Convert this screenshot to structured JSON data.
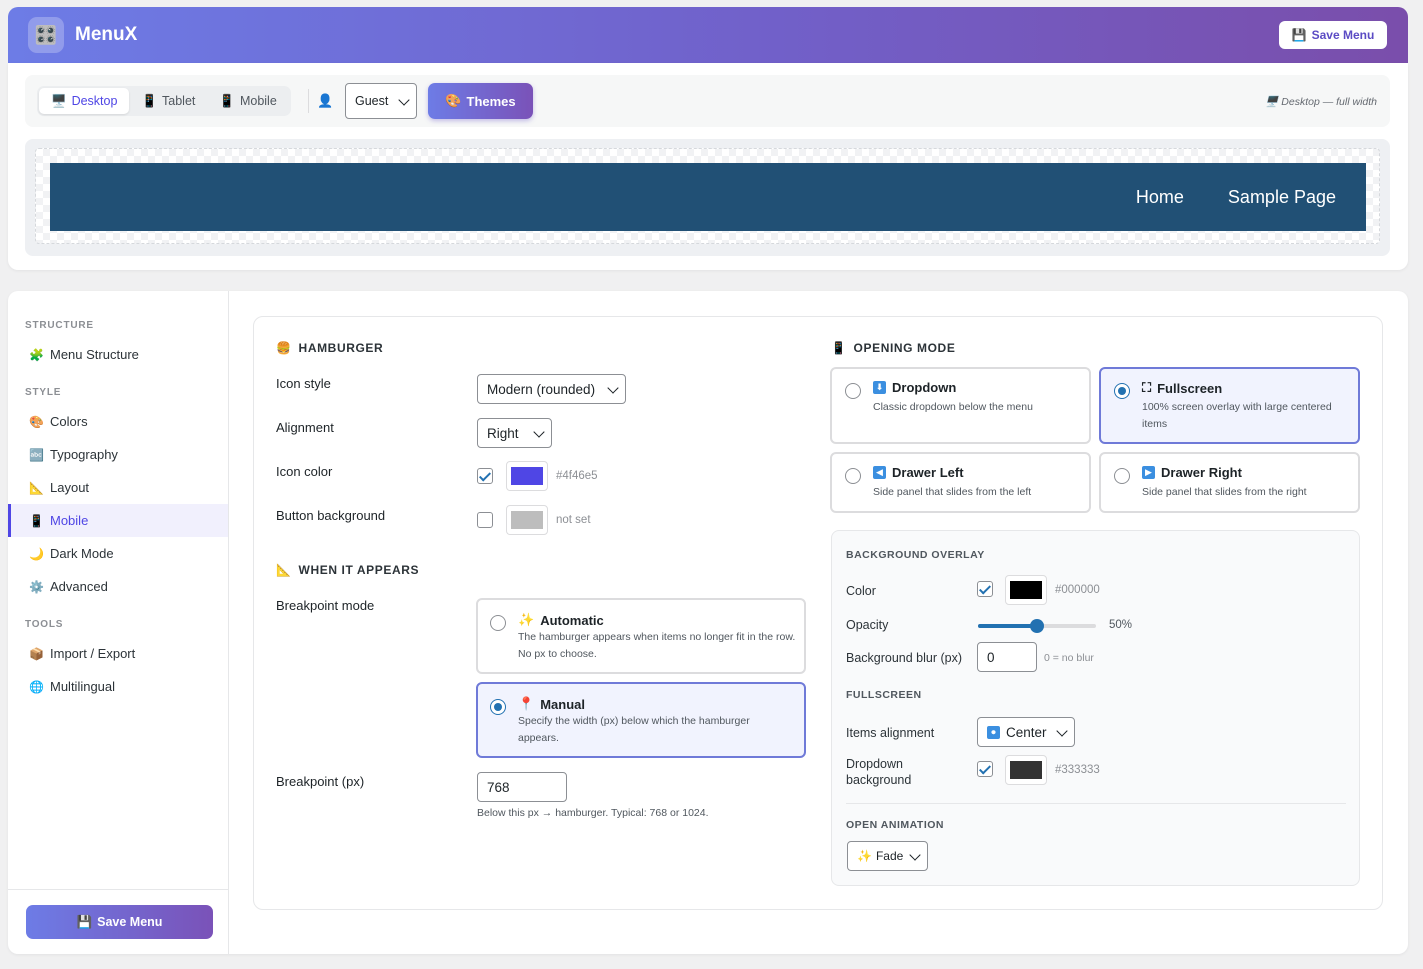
{
  "app": {
    "title": "MenuX",
    "logo_icon": "🎛️",
    "save_label": "Save Menu",
    "save_icon": "💾"
  },
  "toolbar": {
    "devices": [
      {
        "icon": "🖥️",
        "label": "Desktop",
        "active": true
      },
      {
        "icon": "📱",
        "label": "Tablet",
        "active": false
      },
      {
        "icon": "📱",
        "label": "Mobile",
        "active": false
      }
    ],
    "user_icon": "👤",
    "role_select": "Guest",
    "themes_icon": "🎨",
    "themes_label": "Themes",
    "mode_hint": "🖥️ Desktop — full width"
  },
  "preview": {
    "menu_items": [
      "Home",
      "Sample Page"
    ],
    "bar_color": "#215075"
  },
  "sidebar": {
    "sections": [
      {
        "title": "STRUCTURE",
        "items": [
          {
            "icon": "🧩",
            "label": "Menu Structure"
          }
        ]
      },
      {
        "title": "STYLE",
        "items": [
          {
            "icon": "🎨",
            "label": "Colors"
          },
          {
            "icon": "🔤",
            "label": "Typography"
          },
          {
            "icon": "📐",
            "label": "Layout"
          },
          {
            "icon": "📱",
            "label": "Mobile",
            "active": true
          },
          {
            "icon": "🌙",
            "label": "Dark Mode"
          },
          {
            "icon": "⚙️",
            "label": "Advanced"
          }
        ]
      },
      {
        "title": "TOOLS",
        "items": [
          {
            "icon": "📦",
            "label": "Import / Export"
          },
          {
            "icon": "🌐",
            "label": "Multilingual"
          }
        ]
      }
    ],
    "save_label": "Save Menu"
  },
  "hamburger": {
    "title": "HAMBURGER",
    "icon": "🍔",
    "icon_style_label": "Icon style",
    "icon_style_value": "Modern (rounded)",
    "alignment_label": "Alignment",
    "alignment_value": "Right",
    "icon_color_label": "Icon color",
    "icon_color_checked": true,
    "icon_color_hex": "#4f46e5",
    "button_bg_label": "Button background",
    "button_bg_checked": false,
    "button_bg_value": "not set"
  },
  "when_appears": {
    "title": "WHEN IT APPEARS",
    "icon": "📐",
    "breakpoint_mode_label": "Breakpoint mode",
    "modes": [
      {
        "icon": "✨",
        "title": "Automatic",
        "desc": "The hamburger appears when items no longer fit in the row. No px to choose.",
        "selected": false
      },
      {
        "icon": "📍",
        "title": "Manual",
        "desc": "Specify the width (px) below which the hamburger appears.",
        "selected": true
      }
    ],
    "breakpoint_label": "Breakpoint (px)",
    "breakpoint_value": "768",
    "breakpoint_help": "Below this px → hamburger. Typical: 768 or 1024."
  },
  "opening_mode": {
    "title": "OPENING MODE",
    "icon": "📱",
    "options": [
      {
        "icon": "⬇",
        "title": "Dropdown",
        "desc": "Classic dropdown below the menu",
        "selected": false
      },
      {
        "icon": "⛶",
        "title": "Fullscreen",
        "desc": "100% screen overlay with large centered items",
        "selected": true
      },
      {
        "icon": "◀",
        "title": "Drawer Left",
        "desc": "Side panel that slides from the left",
        "selected": false
      },
      {
        "icon": "▶",
        "title": "Drawer Right",
        "desc": "Side panel that slides from the right",
        "selected": false
      }
    ]
  },
  "overlay": {
    "title": "BACKGROUND OVERLAY",
    "color_label": "Color",
    "color_checked": true,
    "color_hex": "#000000",
    "opacity_label": "Opacity",
    "opacity_value": 50,
    "opacity_text": "50%",
    "blur_label": "Background blur (px)",
    "blur_value": "0",
    "blur_help": "0 = no blur"
  },
  "fullscreen": {
    "title": "FULLSCREEN",
    "items_alignment_label": "Items alignment",
    "items_alignment_value": "Center",
    "items_alignment_icon": "⏺",
    "dropdown_bg_label_1": "Dropdown",
    "dropdown_bg_label_2": "background",
    "dropdown_bg_checked": true,
    "dropdown_bg_hex": "#333333"
  },
  "animation": {
    "title": "OPEN ANIMATION",
    "value": "Fade",
    "icon": "✨"
  }
}
